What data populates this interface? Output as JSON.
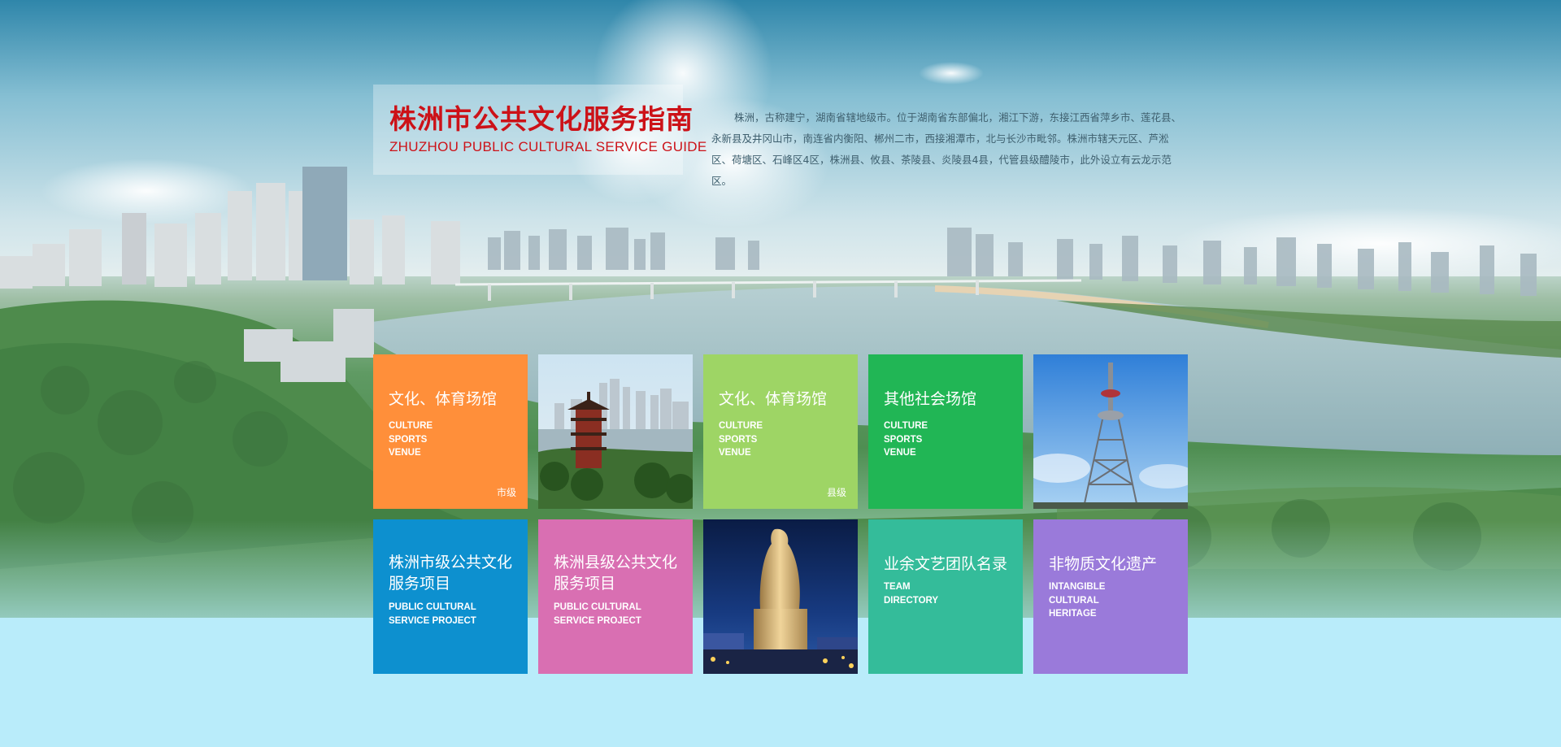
{
  "header": {
    "title_cn": "株洲市公共文化服务指南",
    "title_en": "ZHUZHOU PUBLIC CULTURAL SERVICE GUIDE"
  },
  "intro": "株洲，古称建宁，湖南省辖地级市。位于湖南省东部偏北，湘江下游，东接江西省萍乡市、莲花县、永新县及井冈山市，南连省内衡阳、郴州二市，西接湘潭市，北与长沙市毗邻。株洲市辖天元区、芦淞区、荷塘区、石峰区4区，株洲县、攸县、茶陵县、炎陵县4县，代管县级醴陵市，此外设立有云龙示范区。",
  "tiles": [
    {
      "cn": "文化、体育场馆",
      "en": "CULTURE\nSPORTS\nVENUE",
      "tag": "市级",
      "color": "#ff8f3a"
    },
    {
      "photo": "tower-pavilion-photo"
    },
    {
      "cn": "文化、体育场馆",
      "en": "CULTURE\nSPORTS\nVENUE",
      "tag": "县级",
      "color": "#9ed565"
    },
    {
      "cn": "其他社会场馆",
      "en": "CULTURE\nSPORTS\nVENUE",
      "tag": "",
      "color": "#21b655"
    },
    {
      "photo": "tv-tower-photo"
    },
    {
      "cn": "株洲市级公共文化服务项目",
      "en": "PUBLIC CULTURAL\nSERVICE PROJECT",
      "color": "#0d90cf"
    },
    {
      "cn": "株洲县级公共文化服务项目",
      "en": "PUBLIC CULTURAL\nSERVICE PROJECT",
      "color": "#d96fb2"
    },
    {
      "photo": "statue-photo"
    },
    {
      "cn": "业余文艺团队名录",
      "en": "TEAM\nDIRECTORY",
      "color": "#34bc9a"
    },
    {
      "cn": "非物质文化遗产",
      "en": "INTANGIBLE\nCULTURAL\nHERITAGE",
      "color": "#9a7ada"
    }
  ]
}
